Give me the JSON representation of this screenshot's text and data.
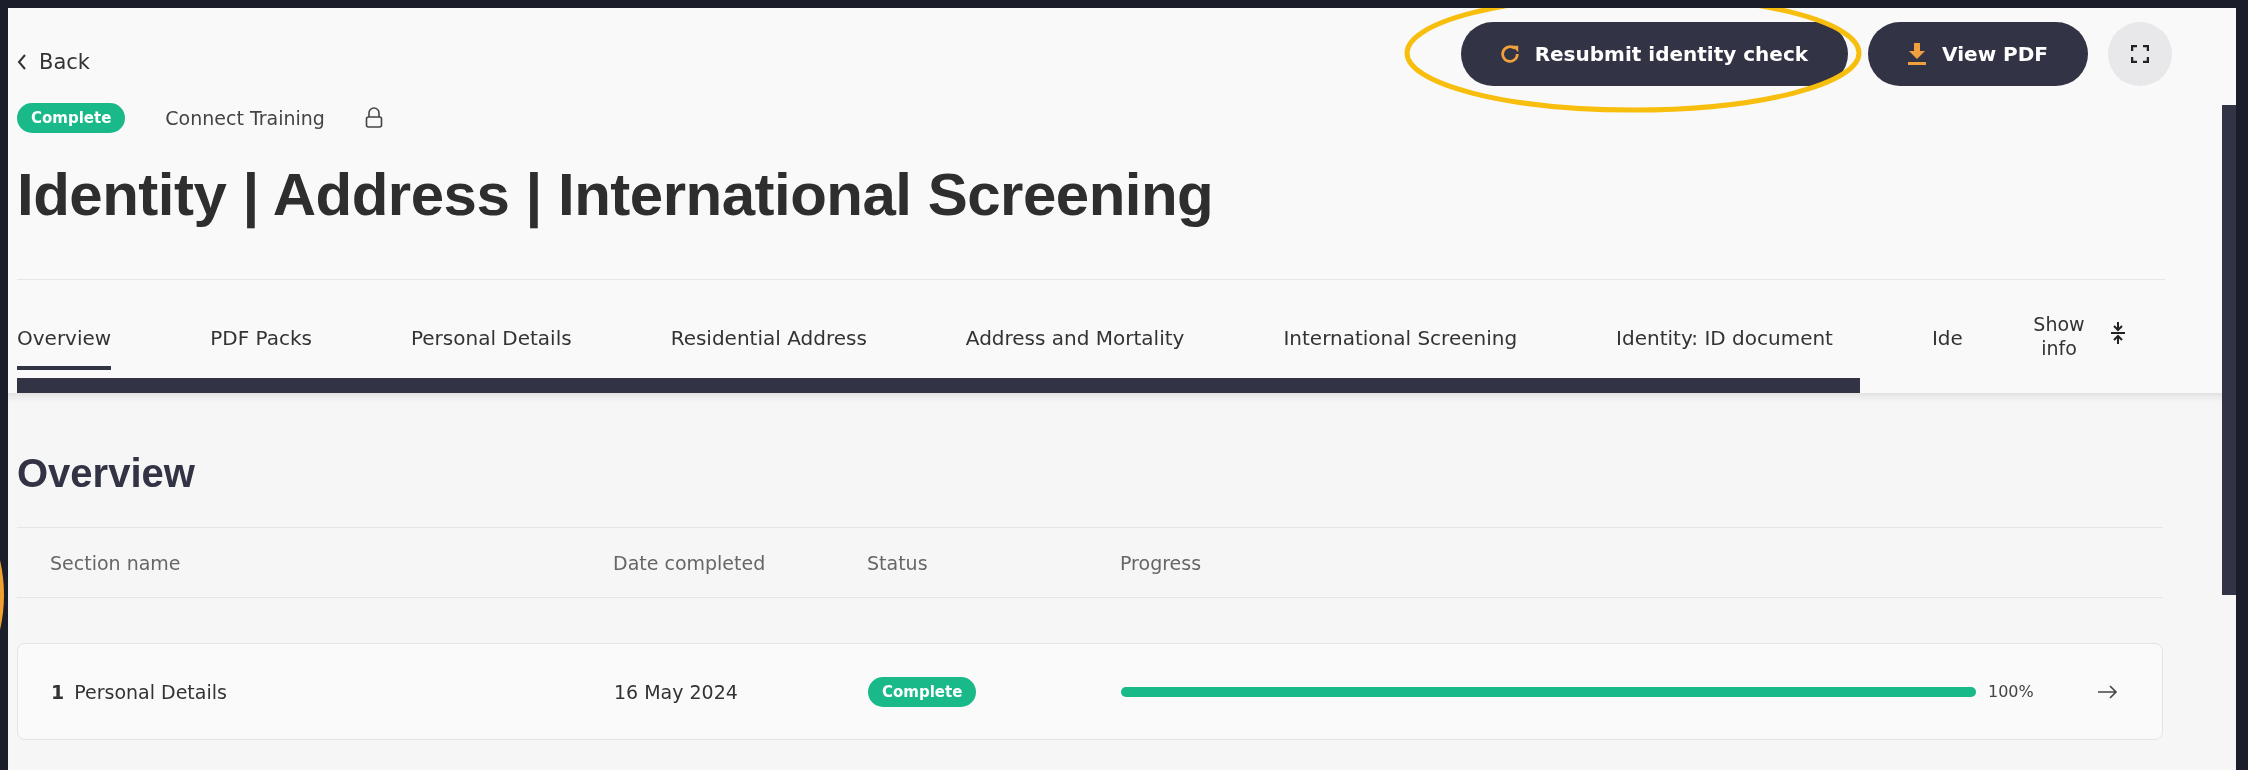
{
  "header": {
    "back": "Back",
    "actions": [
      {
        "kind": "resubmit",
        "label": "Resubmit identity check"
      },
      {
        "kind": "download",
        "label": "View PDF"
      }
    ]
  },
  "annotation": {
    "kind": "ellipse"
  },
  "meta": {
    "status": "Complete",
    "program": "Connect Training",
    "locked": true
  },
  "title": "Identity | Address | International Screening",
  "tabs": [
    {
      "label": "Overview",
      "selected": true
    },
    {
      "label": "PDF Packs",
      "selected": false
    },
    {
      "label": "Personal Details",
      "selected": false
    },
    {
      "label": "Residential Address",
      "selected": false
    },
    {
      "label": "Address and Mortality",
      "selected": false
    },
    {
      "label": "International Screening",
      "selected": false
    },
    {
      "label": "Identity: ID document",
      "selected": false
    },
    {
      "label": "Ide",
      "selected": false
    }
  ],
  "show_info": "Show info",
  "overview": {
    "heading": "Overview",
    "columns": [
      "Section name",
      "Date completed",
      "Status",
      "Progress"
    ],
    "rows": [
      {
        "number": "1",
        "name": "Personal Details",
        "date": "16 May 2024",
        "status": "Complete",
        "level": 1,
        "percent": "100%"
      }
    ]
  }
}
